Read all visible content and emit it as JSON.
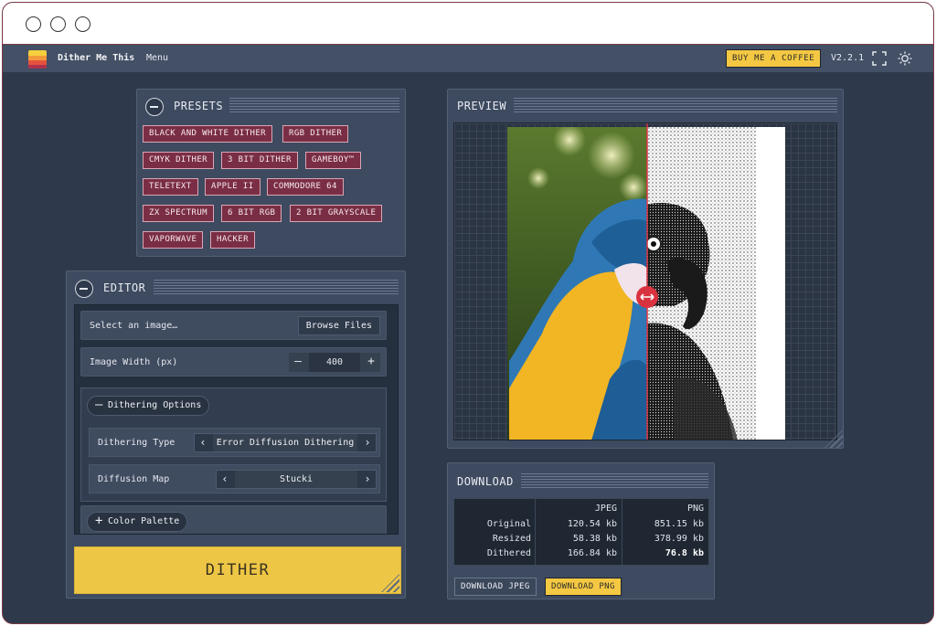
{
  "app": {
    "title": "Dither Me This",
    "menu_label": "Menu",
    "coffee_label": "BUY ME A COFFEE",
    "version": "V2.2.1"
  },
  "presets": {
    "title": "PRESETS",
    "items": [
      "BLACK AND WHITE DITHER",
      "RGB DITHER",
      "CMYK DITHER",
      "3 BIT DITHER",
      "GAMEBOY™",
      "TELETEXT",
      "APPLE II",
      "COMMODORE 64",
      "ZX SPECTRUM",
      "6 BIT RGB",
      "2 BIT GRAYSCALE",
      "VAPORWAVE",
      "HACKER"
    ]
  },
  "editor": {
    "title": "EDITOR",
    "select_image_label": "Select an image…",
    "browse_label": "Browse Files",
    "width_label": "Image Width (px)",
    "width_value": "400",
    "minus": "—",
    "plus": "+",
    "dithering_options_label": "Dithering Options",
    "dithering_type_label": "Dithering Type",
    "dithering_type_value": "Error Diffusion Dithering",
    "diffusion_map_label": "Diffusion Map",
    "diffusion_map_value": "Stucki",
    "color_palette_label": "Color Palette",
    "dither_button": "DITHER"
  },
  "preview": {
    "title": "PREVIEW"
  },
  "download": {
    "title": "DOWNLOAD",
    "headers": [
      "",
      "JPEG",
      "PNG"
    ],
    "rows": [
      [
        "Original",
        "120.54 kb",
        "851.15 kb"
      ],
      [
        "Resized",
        "58.38 kb",
        "378.99 kb"
      ],
      [
        "Dithered",
        "166.84 kb",
        "76.8 kb"
      ]
    ],
    "jpeg_button": "DOWNLOAD JPEG",
    "png_button": "DOWNLOAD PNG"
  },
  "colors": {
    "accent_yellow": "#f4c842",
    "preset_bg": "#7a2e45",
    "slider_red": "#d9323f"
  }
}
